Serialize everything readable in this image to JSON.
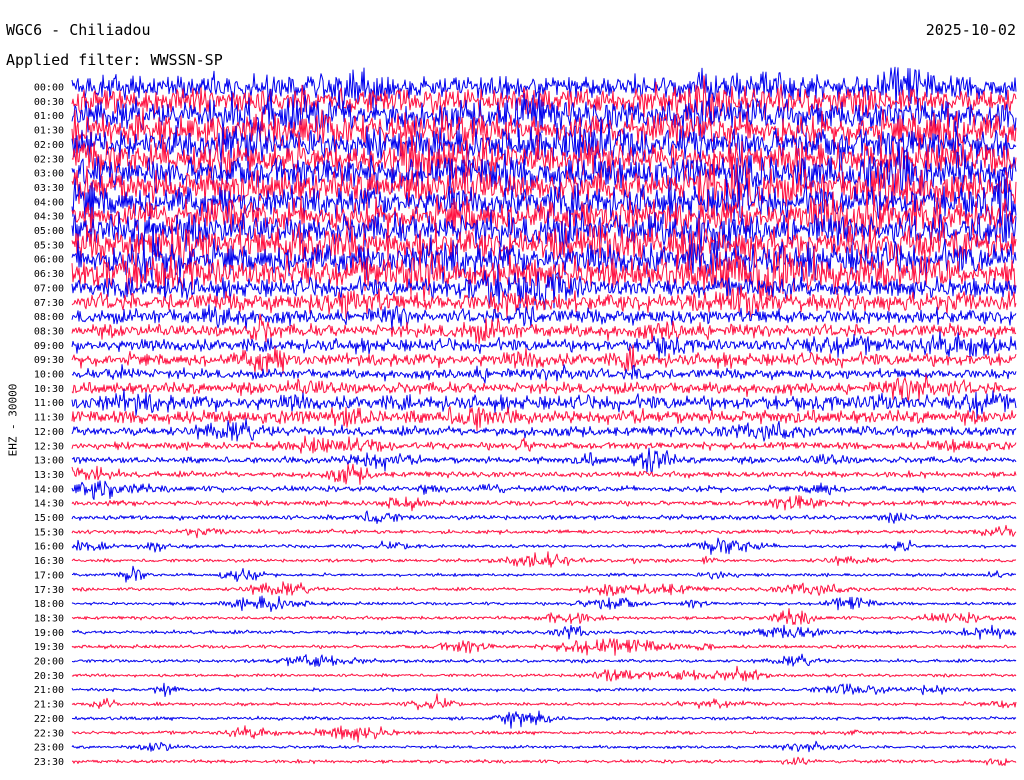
{
  "header": {
    "station": "WGC6 - Chiliadou",
    "date": "2025-10-02",
    "filter": "Applied filter: WWSSN-SP"
  },
  "chart_data": {
    "type": "line",
    "channel_label": "EHZ - 30000",
    "xlabel": "",
    "ylabel": "EHZ - 30000",
    "grid": false,
    "legend": "none",
    "colors": {
      "odd_line": "#0000ee",
      "even_line": "#ff1040"
    },
    "series": [
      {
        "time": "00:00",
        "relative_amplitude": 0.7
      },
      {
        "time": "00:30",
        "relative_amplitude": 0.85
      },
      {
        "time": "01:00",
        "relative_amplitude": 0.95
      },
      {
        "time": "01:30",
        "relative_amplitude": 1.0
      },
      {
        "time": "02:00",
        "relative_amplitude": 1.0
      },
      {
        "time": "02:30",
        "relative_amplitude": 1.0
      },
      {
        "time": "03:00",
        "relative_amplitude": 1.0
      },
      {
        "time": "03:30",
        "relative_amplitude": 1.0
      },
      {
        "time": "04:00",
        "relative_amplitude": 1.0
      },
      {
        "time": "04:30",
        "relative_amplitude": 1.0
      },
      {
        "time": "05:00",
        "relative_amplitude": 1.0
      },
      {
        "time": "05:30",
        "relative_amplitude": 1.0
      },
      {
        "time": "06:00",
        "relative_amplitude": 1.0
      },
      {
        "time": "06:30",
        "relative_amplitude": 0.95
      },
      {
        "time": "07:00",
        "relative_amplitude": 0.6
      },
      {
        "time": "07:30",
        "relative_amplitude": 0.55
      },
      {
        "time": "08:00",
        "relative_amplitude": 0.45
      },
      {
        "time": "08:30",
        "relative_amplitude": 0.4
      },
      {
        "time": "09:00",
        "relative_amplitude": 0.4
      },
      {
        "time": "09:30",
        "relative_amplitude": 0.4
      },
      {
        "time": "10:00",
        "relative_amplitude": 0.3
      },
      {
        "time": "10:30",
        "relative_amplitude": 0.35
      },
      {
        "time": "11:00",
        "relative_amplitude": 0.45
      },
      {
        "time": "11:30",
        "relative_amplitude": 0.4
      },
      {
        "time": "12:00",
        "relative_amplitude": 0.3
      },
      {
        "time": "12:30",
        "relative_amplitude": 0.22
      },
      {
        "time": "13:00",
        "relative_amplitude": 0.2
      },
      {
        "time": "13:30",
        "relative_amplitude": 0.18
      },
      {
        "time": "14:00",
        "relative_amplitude": 0.18
      },
      {
        "time": "14:30",
        "relative_amplitude": 0.15
      },
      {
        "time": "15:00",
        "relative_amplitude": 0.14
      },
      {
        "time": "15:30",
        "relative_amplitude": 0.12
      },
      {
        "time": "16:00",
        "relative_amplitude": 0.1
      },
      {
        "time": "16:30",
        "relative_amplitude": 0.1
      },
      {
        "time": "17:00",
        "relative_amplitude": 0.09
      },
      {
        "time": "17:30",
        "relative_amplitude": 0.1
      },
      {
        "time": "18:00",
        "relative_amplitude": 0.09
      },
      {
        "time": "18:30",
        "relative_amplitude": 0.1
      },
      {
        "time": "19:00",
        "relative_amplitude": 0.11
      },
      {
        "time": "19:30",
        "relative_amplitude": 0.1
      },
      {
        "time": "20:00",
        "relative_amplitude": 0.1
      },
      {
        "time": "20:30",
        "relative_amplitude": 0.09
      },
      {
        "time": "21:00",
        "relative_amplitude": 0.1
      },
      {
        "time": "21:30",
        "relative_amplitude": 0.09
      },
      {
        "time": "22:00",
        "relative_amplitude": 0.1
      },
      {
        "time": "22:30",
        "relative_amplitude": 0.1
      },
      {
        "time": "23:00",
        "relative_amplitude": 0.09
      },
      {
        "time": "23:30",
        "relative_amplitude": 0.1
      }
    ]
  }
}
